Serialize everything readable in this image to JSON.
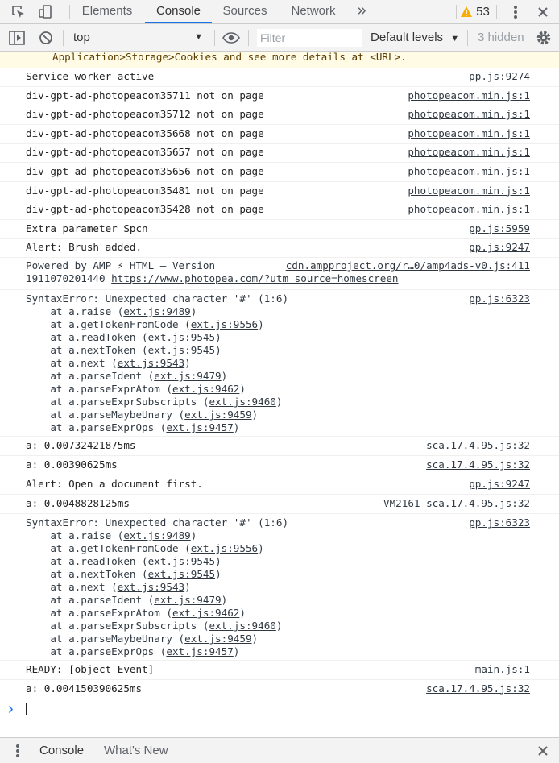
{
  "tabs": {
    "elements": "Elements",
    "console": "Console",
    "sources": "Sources",
    "network": "Network",
    "more": "»",
    "warning_count": "53"
  },
  "toolbar": {
    "context": "top",
    "filter_placeholder": "Filter",
    "levels": "Default levels",
    "hidden": "3 hidden"
  },
  "colors": {
    "accent": "#1a73e8",
    "warning": "#f9ab00",
    "warn_bg": "#fffbe5"
  },
  "log": {
    "cookie_warning": "Application>Storage>Cookies and see more details at <URL>.",
    "rows": [
      {
        "msg": "Service worker active",
        "src": "pp.js:9274"
      },
      {
        "msg": "div-gpt-ad-photopeacom35711 not on page",
        "src": "photopeacom.min.js:1"
      },
      {
        "msg": "div-gpt-ad-photopeacom35712 not on page",
        "src": "photopeacom.min.js:1"
      },
      {
        "msg": "div-gpt-ad-photopeacom35668 not on page",
        "src": "photopeacom.min.js:1"
      },
      {
        "msg": "div-gpt-ad-photopeacom35657 not on page",
        "src": "photopeacom.min.js:1"
      },
      {
        "msg": "div-gpt-ad-photopeacom35656 not on page",
        "src": "photopeacom.min.js:1"
      },
      {
        "msg": "div-gpt-ad-photopeacom35481 not on page",
        "src": "photopeacom.min.js:1"
      },
      {
        "msg": "div-gpt-ad-photopeacom35428 not on page",
        "src": "photopeacom.min.js:1"
      },
      {
        "msg": "Extra parameter Spcn",
        "src": "pp.js:5959"
      },
      {
        "msg": "Alert: Brush added.",
        "src": "pp.js:9247"
      }
    ],
    "amp": {
      "line1": "Powered by AMP ⚡ HTML – Version",
      "line2_prefix": "1911070201440 ",
      "line2_link": "https://www.photopea.com/?utm_source=homescreen",
      "src": "cdn.ampproject.org/r…0/amp4ads-v0.js:411"
    },
    "syntax_error": {
      "title": "SyntaxError: Unexpected character '#' (1:6)",
      "src": "pp.js:6323",
      "frames": [
        {
          "fn": "    at a.raise (",
          "loc": "ext.js:9489"
        },
        {
          "fn": "    at a.getTokenFromCode (",
          "loc": "ext.js:9556"
        },
        {
          "fn": "    at a.readToken (",
          "loc": "ext.js:9545"
        },
        {
          "fn": "    at a.nextToken (",
          "loc": "ext.js:9545"
        },
        {
          "fn": "    at a.next (",
          "loc": "ext.js:9543"
        },
        {
          "fn": "    at a.parseIdent (",
          "loc": "ext.js:9479"
        },
        {
          "fn": "    at a.parseExprAtom (",
          "loc": "ext.js:9462"
        },
        {
          "fn": "    at a.parseExprSubscripts (",
          "loc": "ext.js:9460"
        },
        {
          "fn": "    at a.parseMaybeUnary (",
          "loc": "ext.js:9459"
        },
        {
          "fn": "    at a.parseExprOps (",
          "loc": "ext.js:9457"
        }
      ]
    },
    "rows2": [
      {
        "msg": "a: 0.00732421875ms",
        "src": "sca.17.4.95.js:32"
      },
      {
        "msg": "a: 0.00390625ms",
        "src": "sca.17.4.95.js:32"
      },
      {
        "msg": "Alert: Open a document first.",
        "src": "pp.js:9247"
      },
      {
        "msg": "a: 0.0048828125ms",
        "src": "VM2161 sca.17.4.95.js:32"
      }
    ],
    "rows3": [
      {
        "msg": "READY: [object Event]",
        "src": "main.js:1"
      },
      {
        "msg": "a: 0.004150390625ms",
        "src": "sca.17.4.95.js:32"
      }
    ],
    "prompt_symbol": "›"
  },
  "drawer": {
    "console": "Console",
    "whats_new": "What's New"
  }
}
